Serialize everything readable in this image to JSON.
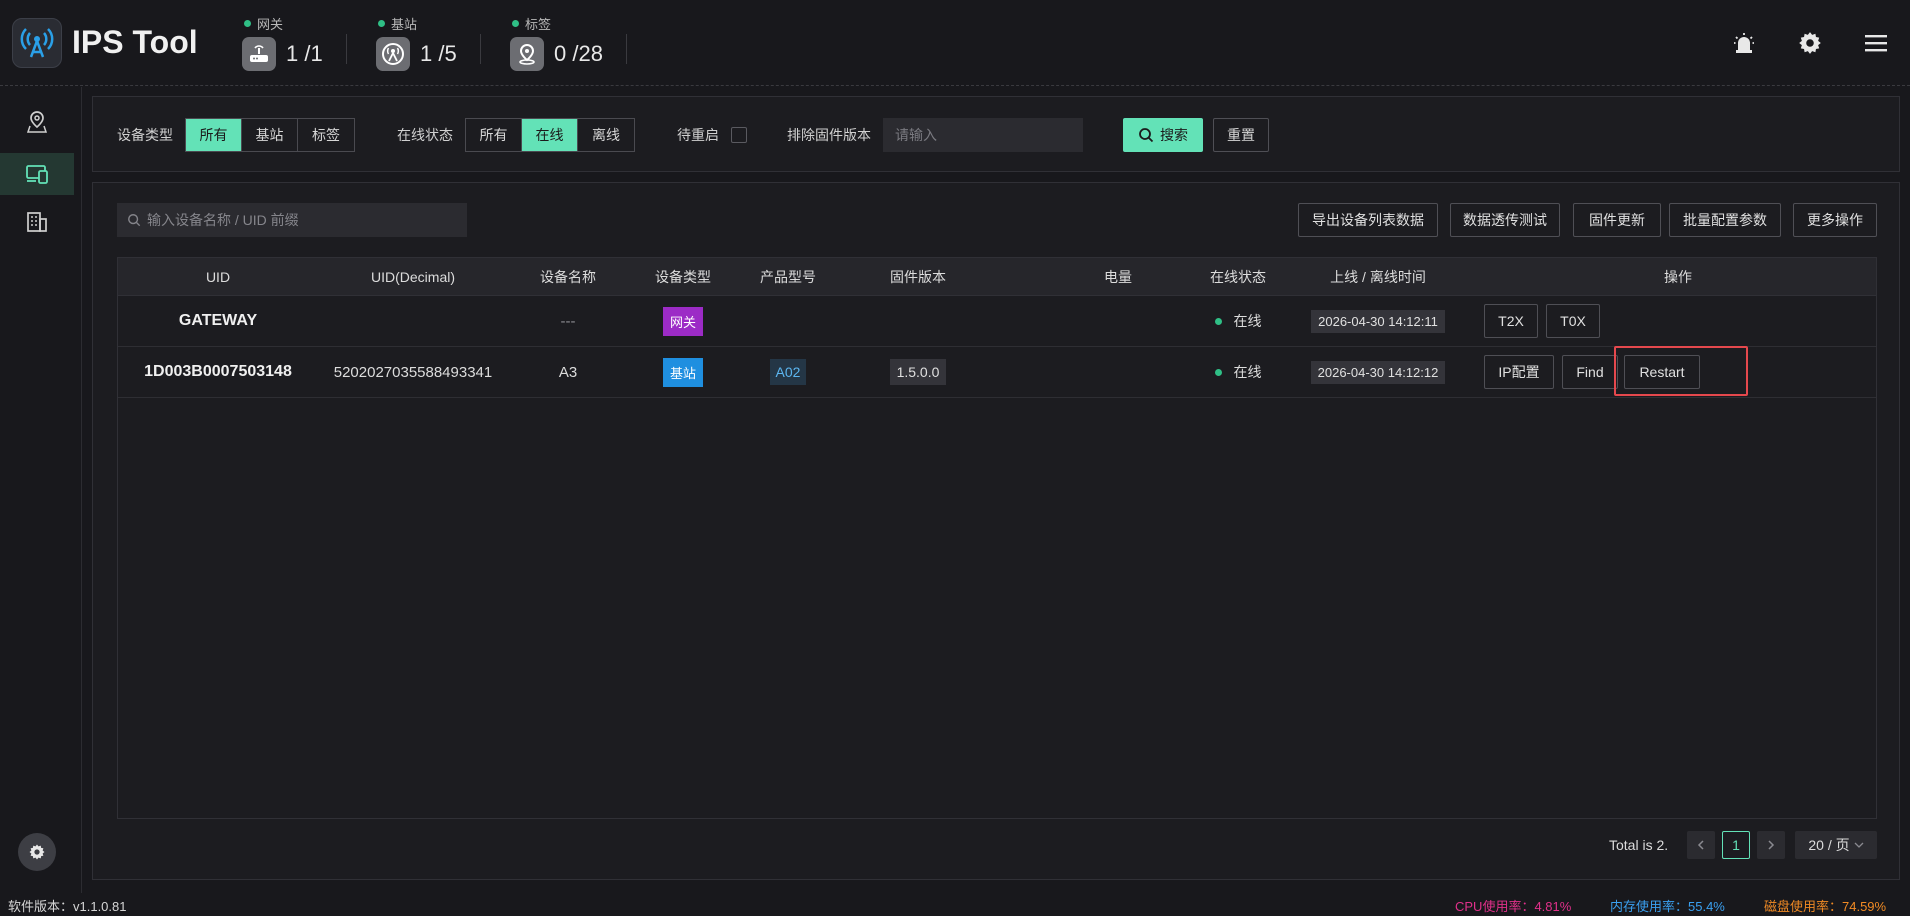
{
  "app": {
    "title": "IPS Tool"
  },
  "stats": [
    {
      "label": "网关",
      "value": "1 /1",
      "icon": "router-icon"
    },
    {
      "label": "基站",
      "value": "1 /5",
      "icon": "antenna-icon"
    },
    {
      "label": "标签",
      "value": "0 /28",
      "icon": "location-pin-icon"
    }
  ],
  "header_icons": [
    "alarm-icon",
    "gear-icon",
    "menu-icon"
  ],
  "sidebar": {
    "items": [
      {
        "icon": "map-pin-icon",
        "active": false
      },
      {
        "icon": "devices-icon",
        "active": true
      },
      {
        "icon": "building-icon",
        "active": false
      }
    ]
  },
  "filters": {
    "device_type_label": "设备类型",
    "device_type_options": [
      "所有",
      "基站",
      "标签"
    ],
    "device_type_selected": "所有",
    "online_label": "在线状态",
    "online_options": [
      "所有",
      "在线",
      "离线"
    ],
    "online_selected": "在线",
    "pending_restart_label": "待重启",
    "pending_restart_checked": false,
    "exclude_fw_label": "排除固件版本",
    "exclude_fw_placeholder": "请输入",
    "search_label": "搜索",
    "reset_label": "重置"
  },
  "toolbar": {
    "search_placeholder": "输入设备名称 / UID 前缀",
    "export_label": "导出设备列表数据",
    "passthrough_label": "数据透传测试",
    "firmware_label": "固件更新",
    "batch_label": "批量配置参数",
    "more_label": "更多操作"
  },
  "table": {
    "headers": [
      "UID",
      "UID(Decimal)",
      "设备名称",
      "设备类型",
      "产品型号",
      "固件版本",
      "电量",
      "在线状态",
      "上线 / 离线时间",
      "操作"
    ],
    "rows": [
      {
        "uid": "GATEWAY",
        "uid_decimal": "",
        "name": "---",
        "type": "网关",
        "model": "",
        "firmware": "",
        "battery": "",
        "status": "在线",
        "time": "2026-04-30 14:12:11",
        "actions": [
          "T2X",
          "T0X"
        ]
      },
      {
        "uid": "1D003B0007503148",
        "uid_decimal": "5202027035588493341",
        "name": "A3",
        "type": "基站",
        "model": "A02",
        "firmware": "1.5.0.0",
        "battery": "",
        "status": "在线",
        "time": "2026-04-30 14:12:12",
        "actions": [
          "IP配置",
          "Find",
          "Restart"
        ]
      }
    ]
  },
  "pagination": {
    "total_text": "Total is 2.",
    "current_page": "1",
    "page_size": "20 / 页"
  },
  "statusbar": {
    "version": "软件版本：v1.1.0.81",
    "cpu": "CPU使用率：4.81%",
    "memory": "内存使用率：55.4%",
    "disk": "磁盘使用率：74.59%",
    "colors": {
      "cpu": "#e0308a",
      "memory": "#3aa0f0",
      "disk": "#f08a24"
    }
  },
  "colors": {
    "accent": "#63e2b7",
    "highlight": "#e5484d",
    "online": "#2fbf86"
  }
}
